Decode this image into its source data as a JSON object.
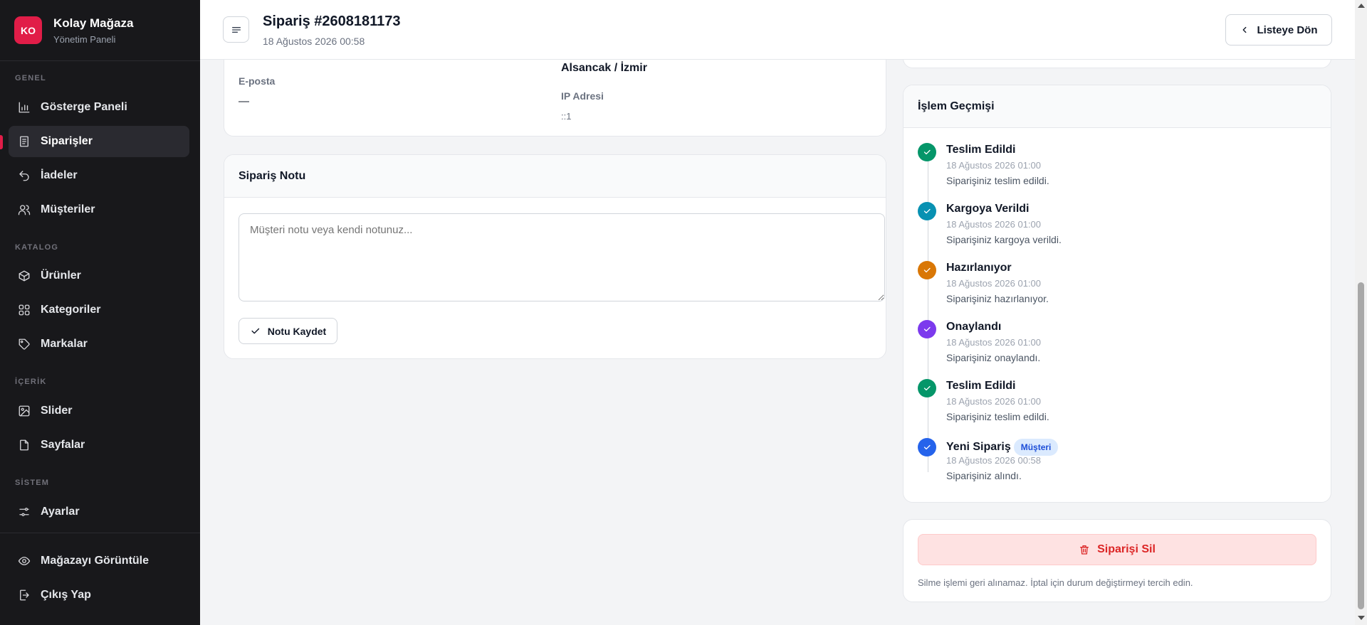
{
  "brand": {
    "initials": "KO",
    "name": "Kolay Mağaza",
    "subtitle": "Yönetim Paneli"
  },
  "sidebar": {
    "sections": {
      "general": "GENEL",
      "catalog": "KATALOG",
      "content": "İÇERİK",
      "system": "SİSTEM"
    },
    "items": {
      "dashboard": "Gösterge Paneli",
      "orders": "Siparişler",
      "returns": "İadeler",
      "customers": "Müşteriler",
      "products": "Ürünler",
      "categories": "Kategoriler",
      "brands": "Markalar",
      "slider": "Slider",
      "pages": "Sayfalar",
      "settings": "Ayarlar",
      "view_store": "Mağazayı Görüntüle",
      "logout": "Çıkış Yap"
    }
  },
  "header": {
    "title": "Sipariş #2608181173",
    "date": "18 Ağustos 2026 00:58",
    "back_label": "Listeye Dön"
  },
  "customer_card": {
    "email_label": "E-posta",
    "email_value": "—",
    "location_value": "Alsancak / İzmir",
    "ip_label": "IP Adresi",
    "ip_value": "::1"
  },
  "note_card": {
    "title": "Sipariş Notu",
    "placeholder": "Müşteri notu veya kendi notunuz...",
    "save_label": "Notu Kaydet"
  },
  "history_card": {
    "title": "İşlem Geçmişi",
    "events": [
      {
        "title": "Teslim Edildi",
        "date": "18 Ağustos 2026 01:00",
        "desc": "Siparişiniz teslim edildi.",
        "color": "#059669"
      },
      {
        "title": "Kargoya Verildi",
        "date": "18 Ağustos 2026 01:00",
        "desc": "Siparişiniz kargoya verildi.",
        "color": "#0891b2"
      },
      {
        "title": "Hazırlanıyor",
        "date": "18 Ağustos 2026 01:00",
        "desc": "Siparişiniz hazırlanıyor.",
        "color": "#d97706"
      },
      {
        "title": "Onaylandı",
        "date": "18 Ağustos 2026 01:00",
        "desc": "Siparişiniz onaylandı.",
        "color": "#7c3aed"
      },
      {
        "title": "Teslim Edildi",
        "date": "18 Ağustos 2026 01:00",
        "desc": "Siparişiniz teslim edildi.",
        "color": "#059669"
      },
      {
        "title": "Yeni Sipariş",
        "badge": "Müşteri",
        "date": "18 Ağustos 2026 00:58",
        "desc": "Siparişiniz alındı.",
        "color": "#2563eb"
      }
    ]
  },
  "danger_card": {
    "delete_label": "Siparişi Sil",
    "warning": "Silme işlemi geri alınamaz. İptal için durum değiştirmeyi tercih edin."
  },
  "colors": {
    "accent": "#e11d48",
    "sidebar_bg": "#18181b",
    "danger": "#dc2626"
  }
}
